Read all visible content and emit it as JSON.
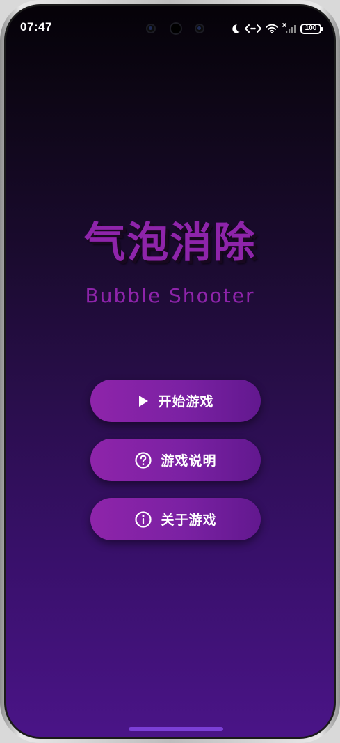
{
  "status_bar": {
    "time": "07:47",
    "battery_level": "100",
    "icons": [
      "moon-icon",
      "data-transfer-icon",
      "wifi-icon",
      "signal-off-icon",
      "battery-icon"
    ]
  },
  "header": {
    "title": "气泡消除",
    "subtitle": "Bubble Shooter"
  },
  "menu": {
    "start_label": "开始游戏",
    "start_icon": "play-icon",
    "help_label": "游戏说明",
    "help_icon": "help-circle-icon",
    "about_label": "关于游戏",
    "about_icon": "info-circle-icon"
  },
  "colors": {
    "accent": "#8e24aa",
    "background_top": "#050208",
    "background_bottom": "#4a1487",
    "button_text": "#ffffff"
  }
}
